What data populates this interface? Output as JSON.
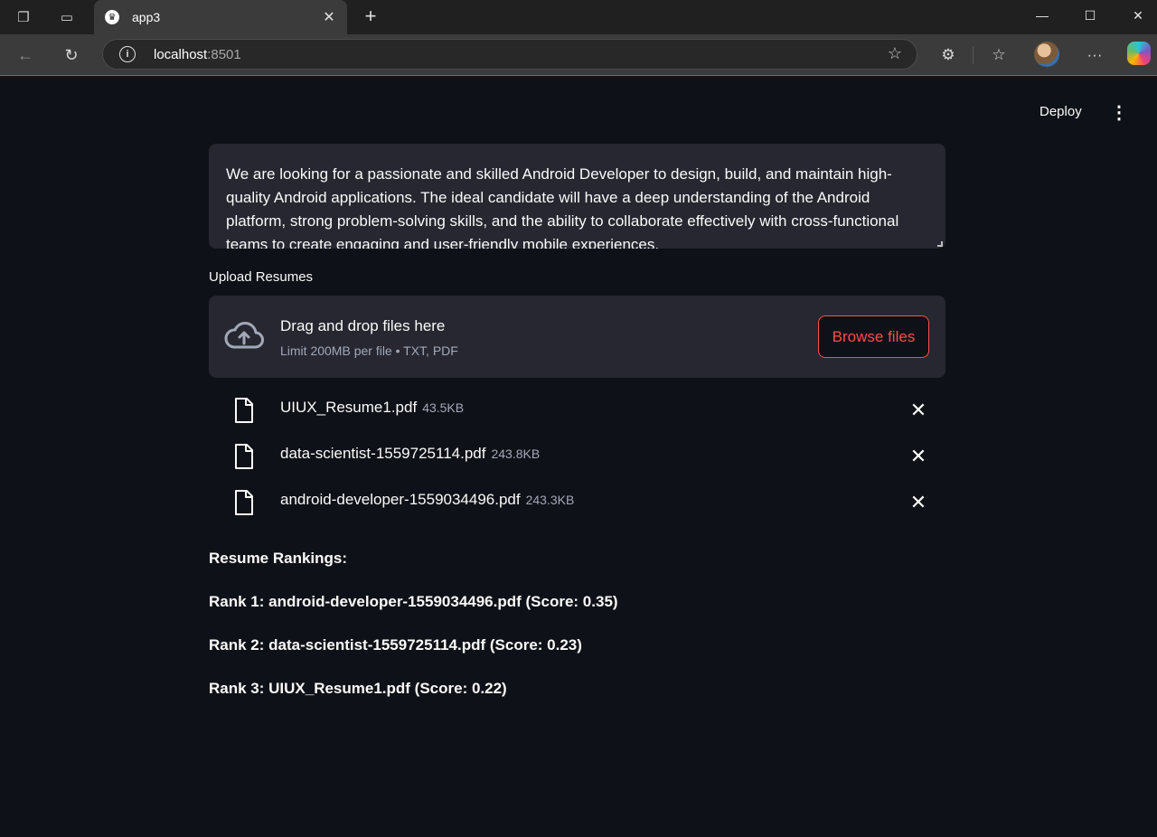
{
  "browser": {
    "tab_title": "app3",
    "url_host": "localhost",
    "url_port": ":8501"
  },
  "header": {
    "deploy_label": "Deploy"
  },
  "job_description": {
    "text": "We are looking for a passionate and skilled Android Developer to design, build, and maintain high-quality Android applications. The ideal candidate will have a deep understanding of the Android platform, strong problem-solving skills, and the ability to collaborate effectively with cross-functional teams to create engaging and user-friendly mobile experiences."
  },
  "uploader": {
    "label": "Upload Resumes",
    "drop_title": "Drag and drop files here",
    "drop_subtitle": "Limit 200MB per file • TXT, PDF",
    "browse_label": "Browse files",
    "files": [
      {
        "name": "UIUX_Resume1.pdf",
        "size": "43.5KB"
      },
      {
        "name": "data-scientist-1559725114.pdf",
        "size": "243.8KB"
      },
      {
        "name": "android-developer-1559034496.pdf",
        "size": "243.3KB"
      }
    ]
  },
  "rankings": {
    "heading": "Resume Rankings:",
    "items": [
      "Rank 1: android-developer-1559034496.pdf (Score: 0.35)",
      "Rank 2: data-scientist-1559725114.pdf (Score: 0.23)",
      "Rank 3: UIUX_Resume1.pdf (Score: 0.22)"
    ]
  },
  "colors": {
    "background": "#0e1117",
    "widget": "#262730",
    "accent": "#ff4b4b",
    "muted_text": "#a3a8b8"
  }
}
